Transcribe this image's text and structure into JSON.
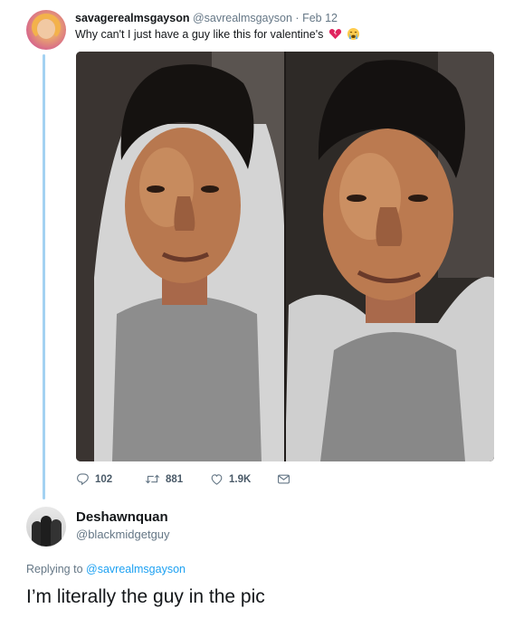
{
  "tweet": {
    "display_name": "savagerealmsgayson",
    "handle": "@savrealmsgayson",
    "separator": "·",
    "date": "Feb 12",
    "text": "Why can't I just have a guy like this for valentine's",
    "emojis": [
      "broken-heart-emoji",
      "crying-face-emoji"
    ],
    "stats": {
      "replies": "102",
      "retweets": "881",
      "likes": "1.9K"
    }
  },
  "reply": {
    "display_name": "Deshawnquan",
    "handle": "@blackmidgetguy",
    "replying_prefix": "Replying to",
    "replying_to": "@savrealmsgayson",
    "text": "I’m literally the guy in the pic"
  },
  "colors": {
    "thread_line": "#a3d2f2",
    "link": "#1da1f2",
    "muted": "#657786",
    "text": "#14171a"
  },
  "icons": {
    "reply": "reply-icon",
    "retweet": "retweet-icon",
    "like": "heart-icon",
    "message": "envelope-icon"
  }
}
